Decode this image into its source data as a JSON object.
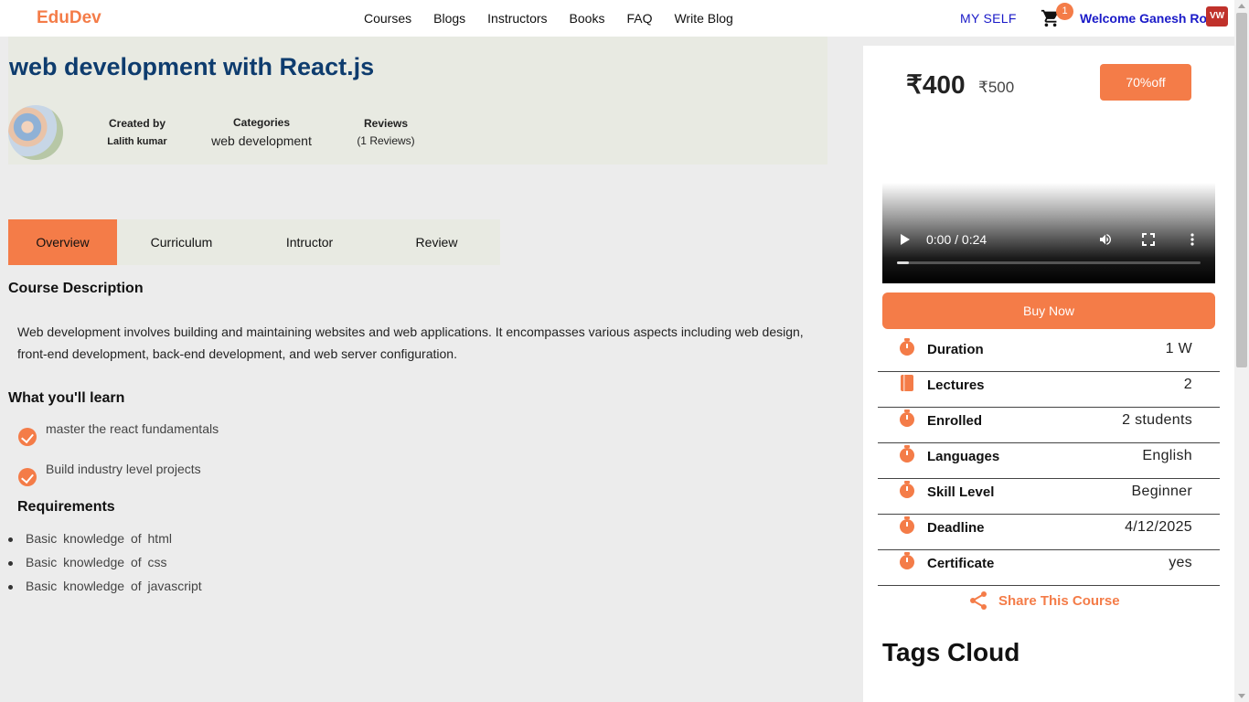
{
  "header": {
    "logo": "EduDev",
    "nav": [
      "Courses",
      "Blogs",
      "Instructors",
      "Books",
      "FAQ",
      "Write Blog"
    ],
    "my_self": "MY SELF",
    "cart_count": "1",
    "welcome": "Welcome Ganesh Rows",
    "extension_badge": "VW"
  },
  "course": {
    "title": "web development with React.js",
    "created_by_label": "Created by",
    "created_by": "Lalith kumar",
    "categories_label": "Categories",
    "category": "web development",
    "reviews_label": "Reviews",
    "reviews": "(1 Reviews)"
  },
  "tabs": [
    "Overview",
    "Curriculum",
    "Intructor",
    "Review"
  ],
  "overview": {
    "description_heading": "Course Description",
    "description": "Web development involves building and maintaining websites and web applications. It encompasses various aspects including web design, front-end development, back-end development, and web server configuration.",
    "learn_heading": "What you'll learn",
    "learn_items": [
      "master the react fundamentals",
      "Build industry level projects"
    ],
    "requirements_heading": "Requirements",
    "requirements": [
      "Basic knowledge of html",
      "Basic knowledge of css",
      "Basic knowledge of javascript"
    ]
  },
  "sidebar": {
    "price": "₹400",
    "old_price": "₹500",
    "discount": "70%off",
    "video_time": "0:00 / 0:24",
    "video_progress": 0.04,
    "buy_label": "Buy Now",
    "info": [
      {
        "label": "Duration",
        "value": "1 W",
        "icon": "timer-icon"
      },
      {
        "label": "Lectures",
        "value": "2",
        "icon": "book-icon"
      },
      {
        "label": "Enrolled",
        "value": "2 students",
        "icon": "timer-icon"
      },
      {
        "label": "Languages",
        "value": "English",
        "icon": "timer-icon"
      },
      {
        "label": "Skill Level",
        "value": "Beginner",
        "icon": "timer-icon"
      },
      {
        "label": "Deadline",
        "value": "4/12/2025",
        "icon": "timer-icon"
      },
      {
        "label": "Certificate",
        "value": "yes",
        "icon": "timer-icon"
      }
    ],
    "share_label": "Share This Course",
    "tags_heading": "Tags Cloud"
  },
  "colors": {
    "accent": "#f47c48",
    "title": "#0e3c6e",
    "link": "#1a1ac8",
    "hero_bg": "#e8eae2"
  }
}
